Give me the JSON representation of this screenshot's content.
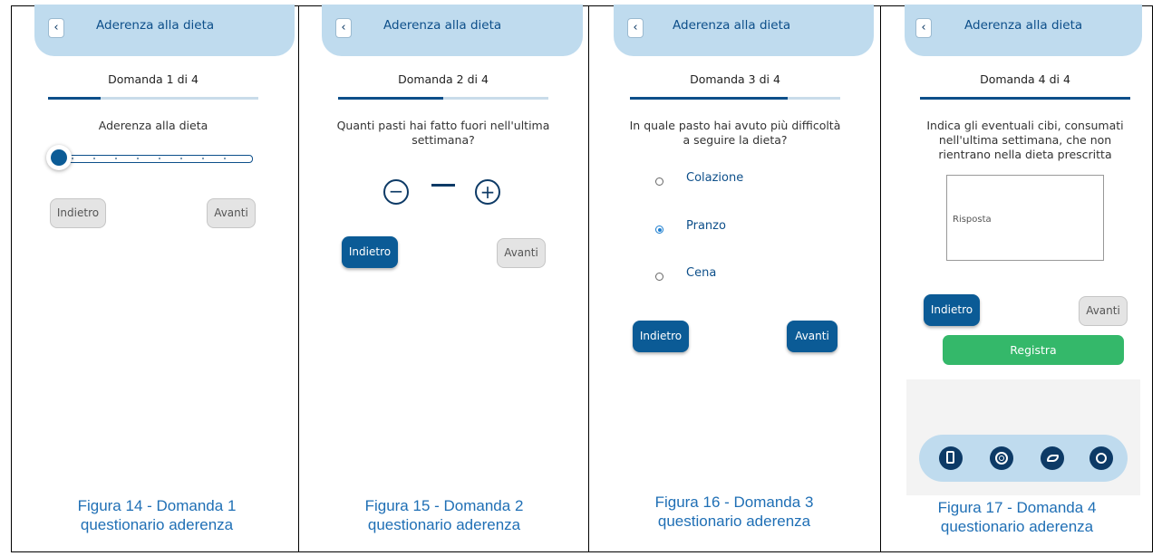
{
  "panels": [
    {
      "header_title": "Aderenza alla dieta",
      "question_number": "Domanda 1 di 4",
      "progress": 0.25,
      "question": "Aderenza alla dieta",
      "back_label": "Indietro",
      "next_label": "Avanti",
      "caption_line1": "Figura 14 - Domanda 1",
      "caption_line2": "questionario aderenza"
    },
    {
      "header_title": "Aderenza alla dieta",
      "question_number": "Domanda 2 di 4",
      "progress": 0.5,
      "question_line1": "Quanti pasti hai fatto fuori nell'ultima",
      "question_line2": "settimana?",
      "minus_symbol": "−",
      "value_dash": "—",
      "plus_symbol": "+",
      "back_label": "Indietro",
      "next_label": "Avanti",
      "caption_line1": "Figura 15 - Domanda 2",
      "caption_line2": "questionario aderenza"
    },
    {
      "header_title": "Aderenza alla dieta",
      "question_number": "Domanda 3 di 4",
      "progress": 0.75,
      "question_line1": "In quale pasto hai avuto più difficoltà",
      "question_line2": "a seguire la dieta?",
      "options": [
        "Colazione",
        "Pranzo",
        "Cena"
      ],
      "selected_option": "Pranzo",
      "back_label": "Indietro",
      "next_label": "Avanti",
      "caption_line1": "Figura 16 - Domanda 3",
      "caption_line2": "questionario aderenza"
    },
    {
      "header_title": "Aderenza alla dieta",
      "question_number": "Domanda 4 di 4",
      "progress": 1.0,
      "question_line1": "Indica gli eventuali cibi, consumati",
      "question_line2": "nell'ultima settimana, che non",
      "question_line3": "rientrano nella dieta prescritta",
      "answer_placeholder": "Risposta",
      "back_label": "Indietro",
      "next_label": "Avanti",
      "submit_label": "Registra",
      "caption_line1": "Figura 17 - Domanda 4",
      "caption_line2": "questionario aderenza"
    }
  ],
  "back_icon": "chevron-left-icon",
  "nav_icons": [
    "diary-icon",
    "fingerprint-icon",
    "running-icon",
    "meal-icon"
  ],
  "colors": {
    "accent": "#0b5b96",
    "header_bg": "#bfdbee",
    "submit": "#34b86a",
    "caption": "#1f6fb5"
  }
}
